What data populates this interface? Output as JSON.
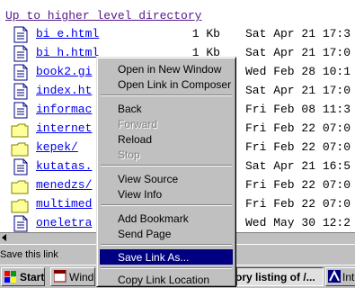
{
  "listing": {
    "up_link": "Up to higher level directory",
    "rows": [
      {
        "icon": "file-icon",
        "name": "bi e.html",
        "size": "1 Kb",
        "date": "Sat Apr 21 17:3"
      },
      {
        "icon": "file-icon",
        "name": "bi h.html",
        "size": "1 Kb",
        "date": "Sat Apr 21 17:0"
      },
      {
        "icon": "file-icon",
        "name": "book2.gi",
        "size": "",
        "date": "Wed Feb 28 10:1"
      },
      {
        "icon": "file-icon",
        "name": "index.ht",
        "size": "",
        "date": "Sat Apr 21 17:0"
      },
      {
        "icon": "file-icon",
        "name": "informac",
        "size": "",
        "date": "Fri Feb 08 11:3"
      },
      {
        "icon": "folder-icon",
        "name": "internet",
        "size": "",
        "date": "Fri Feb 22 07:0"
      },
      {
        "icon": "folder-icon",
        "name": "kepek/",
        "size": "",
        "date": "Fri Feb 22 07:0"
      },
      {
        "icon": "file-icon",
        "name": "kutatas.",
        "size": "",
        "date": "Sat Apr 21 16:5"
      },
      {
        "icon": "folder-icon",
        "name": "menedzs/",
        "size": "",
        "date": "Fri Feb 22 07:0"
      },
      {
        "icon": "folder-icon",
        "name": "multimed",
        "size": "",
        "date": "Fri Feb 22 07:0"
      },
      {
        "icon": "file-icon",
        "name": "oneletra",
        "size": "",
        "date": "Wed May 30 12:2"
      }
    ]
  },
  "status_text": "Save this link",
  "taskbar": {
    "start": "Start",
    "windows_btn": "Windo",
    "listing_btn": "ory listing of /...",
    "inter_btn": "Inte"
  },
  "context_menu": {
    "items": [
      {
        "label": "Open in New Window",
        "disabled": false,
        "highlighted": false
      },
      {
        "label": "Open Link in Composer",
        "disabled": false,
        "highlighted": false
      },
      {
        "sep": true
      },
      {
        "label": "Back",
        "disabled": false,
        "highlighted": false
      },
      {
        "label": "Forward",
        "disabled": true,
        "highlighted": false
      },
      {
        "label": "Reload",
        "disabled": false,
        "highlighted": false
      },
      {
        "label": "Stop",
        "disabled": true,
        "highlighted": false
      },
      {
        "sep": true
      },
      {
        "label": "View Source",
        "disabled": false,
        "highlighted": false
      },
      {
        "label": "View Info",
        "disabled": false,
        "highlighted": false
      },
      {
        "sep": true
      },
      {
        "label": "Add Bookmark",
        "disabled": false,
        "highlighted": false
      },
      {
        "label": "Send Page",
        "disabled": false,
        "highlighted": false
      },
      {
        "sep": true
      },
      {
        "label": "Save Link As...",
        "disabled": false,
        "highlighted": true
      },
      {
        "sep": true
      },
      {
        "label": "Copy Link Location",
        "disabled": false,
        "highlighted": false
      }
    ]
  },
  "colors": {
    "link": "#0000ee",
    "visited": "#551a8b",
    "highlight": "#000080",
    "chrome": "#c0c0c0",
    "folder": "#ffff99"
  }
}
